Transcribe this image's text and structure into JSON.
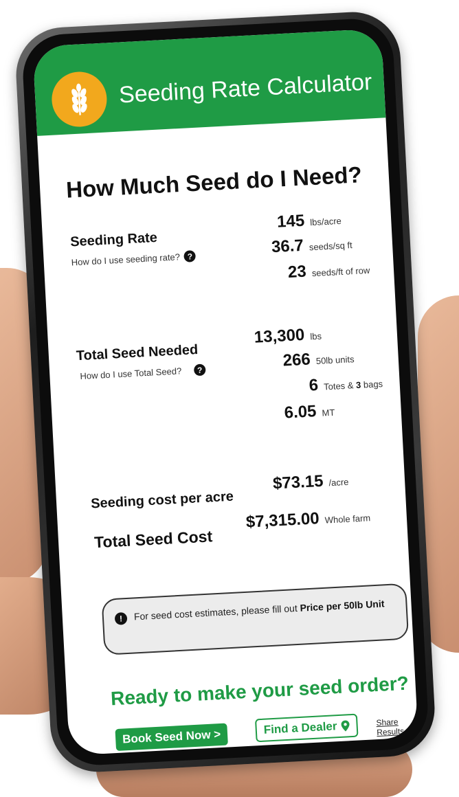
{
  "app": {
    "title": "Seeding Rate Calculator",
    "logo_icon": "wheat-icon"
  },
  "page": {
    "title": "How Much Seed do I Need?"
  },
  "seeding_rate": {
    "label": "Seeding Rate",
    "help": "How do I use seeding rate?",
    "values": [
      {
        "num": "145",
        "unit": "lbs/acre"
      },
      {
        "num": "36.7",
        "unit": "seeds/sq ft"
      },
      {
        "num": "23",
        "unit": "seeds/ft of row"
      }
    ]
  },
  "total_seed": {
    "label": "Total Seed Needed",
    "help": "How do I use Total Seed?",
    "values": [
      {
        "num": "13,300",
        "unit": "lbs"
      },
      {
        "num": "266",
        "unit": "50lb units"
      },
      {
        "num": "6",
        "unit_pre": "Totes & ",
        "unit_bold": "3",
        "unit_post": " bags"
      },
      {
        "num": "6.05",
        "unit": "MT"
      }
    ]
  },
  "costs": {
    "per_acre_label": "Seeding cost per acre",
    "per_acre_value": "$73.15",
    "per_acre_unit": "/acre",
    "total_label": "Total Seed Cost",
    "total_value": "$7,315.00",
    "total_unit": "Whole farm"
  },
  "info": {
    "text": "For seed cost estimates, please fill out ",
    "bold": "Price per 50lb Unit"
  },
  "cta": {
    "title": "Ready to make your seed order?",
    "book_label": "Book Seed Now >",
    "dealer_label": "Find a Dealer",
    "share_label": "Share Results"
  },
  "colors": {
    "brand_green": "#1f9b45",
    "logo_orange": "#f2a81d"
  }
}
